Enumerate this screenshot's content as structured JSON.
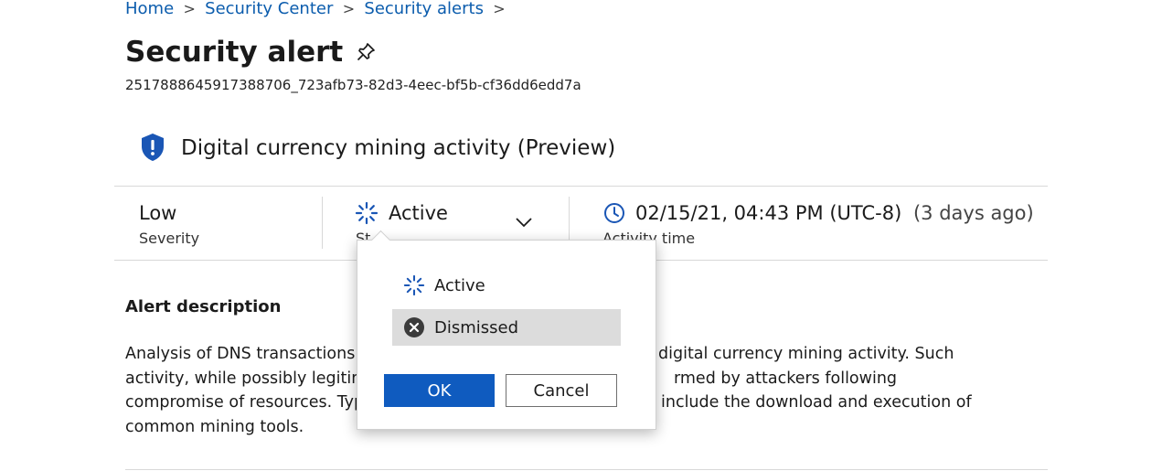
{
  "breadcrumb": {
    "items": [
      "Home",
      "Security Center",
      "Security alerts"
    ],
    "separator": ">"
  },
  "page": {
    "title": "Security alert",
    "alert_id": "2517888645917388706_723afb73-82d3-4eec-bf5b-cf36dd6edd7a"
  },
  "alert": {
    "name": "Digital currency mining activity (Preview)",
    "icon": "shield-exclamation-icon"
  },
  "summary": {
    "severity_value": "Low",
    "severity_label": "Severity",
    "status_value": "Active",
    "status_label_visible": "St",
    "time_value": "02/15/21, 04:43 PM (UTC-8)",
    "time_relative": "(3 days ago)",
    "time_label": "Activity time"
  },
  "description": {
    "title": "Alert description",
    "lines": [
      "Analysis of DNS transactions f",
      "digital currency mining activity. Such",
      "activity, while possibly legitim",
      "rmed by attackers following",
      "compromise of resources. Typ",
      "include the download and execution of",
      "common mining tools."
    ]
  },
  "status_popup": {
    "options": [
      {
        "label": "Active",
        "icon": "spinner-icon",
        "selected": false
      },
      {
        "label": "Dismissed",
        "icon": "dismiss-circle-icon",
        "selected": true
      }
    ],
    "ok_label": "OK",
    "cancel_label": "Cancel"
  },
  "colors": {
    "accent": "#0f5bbf",
    "link": "#0b5cad",
    "shield": "#1a56b5",
    "selected_bg": "#dcdcdc"
  }
}
